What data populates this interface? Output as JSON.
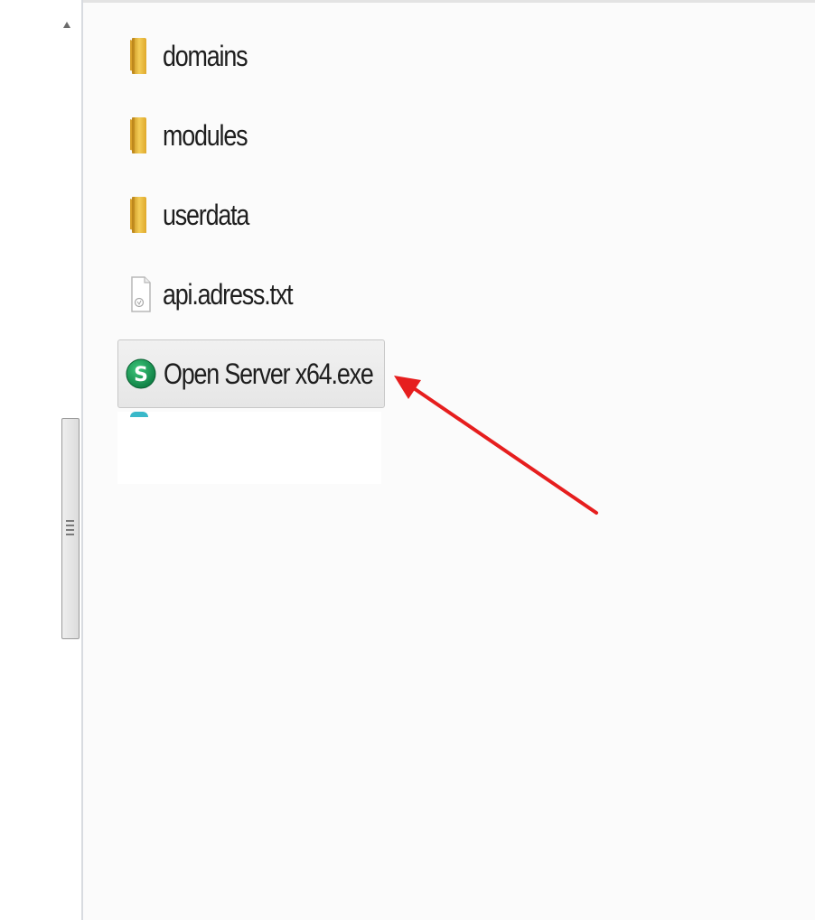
{
  "explorer": {
    "files": [
      {
        "name": "domains",
        "type": "folder",
        "icon": "folder-icon"
      },
      {
        "name": "modules",
        "type": "folder",
        "icon": "folder-icon"
      },
      {
        "name": "userdata",
        "type": "folder",
        "icon": "folder-icon"
      },
      {
        "name": "api.adress.txt",
        "type": "text-file",
        "icon": "text-file-icon"
      },
      {
        "name": "Open Server x64.exe",
        "type": "executable",
        "icon": "open-server-icon",
        "selected": true
      }
    ]
  },
  "colors": {
    "folder": "#e8b93a",
    "open_server": "#0f8a4b",
    "arrow": "#e61e1e",
    "selection": "#e6e6e6"
  }
}
